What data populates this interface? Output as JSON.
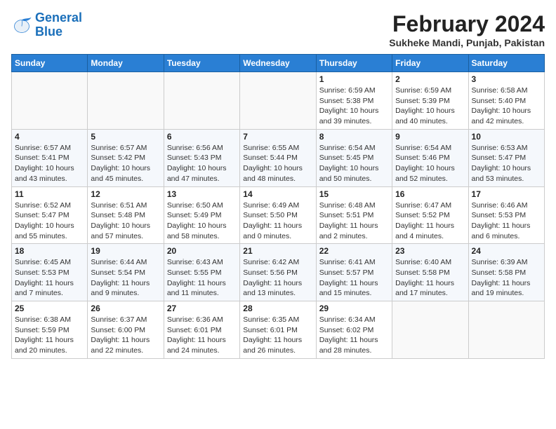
{
  "logo": {
    "line1": "General",
    "line2": "Blue"
  },
  "title": "February 2024",
  "location": "Sukheke Mandi, Punjab, Pakistan",
  "days_of_week": [
    "Sunday",
    "Monday",
    "Tuesday",
    "Wednesday",
    "Thursday",
    "Friday",
    "Saturday"
  ],
  "weeks": [
    [
      {
        "day": "",
        "info": ""
      },
      {
        "day": "",
        "info": ""
      },
      {
        "day": "",
        "info": ""
      },
      {
        "day": "",
        "info": ""
      },
      {
        "day": "1",
        "info": "Sunrise: 6:59 AM\nSunset: 5:38 PM\nDaylight: 10 hours\nand 39 minutes."
      },
      {
        "day": "2",
        "info": "Sunrise: 6:59 AM\nSunset: 5:39 PM\nDaylight: 10 hours\nand 40 minutes."
      },
      {
        "day": "3",
        "info": "Sunrise: 6:58 AM\nSunset: 5:40 PM\nDaylight: 10 hours\nand 42 minutes."
      }
    ],
    [
      {
        "day": "4",
        "info": "Sunrise: 6:57 AM\nSunset: 5:41 PM\nDaylight: 10 hours\nand 43 minutes."
      },
      {
        "day": "5",
        "info": "Sunrise: 6:57 AM\nSunset: 5:42 PM\nDaylight: 10 hours\nand 45 minutes."
      },
      {
        "day": "6",
        "info": "Sunrise: 6:56 AM\nSunset: 5:43 PM\nDaylight: 10 hours\nand 47 minutes."
      },
      {
        "day": "7",
        "info": "Sunrise: 6:55 AM\nSunset: 5:44 PM\nDaylight: 10 hours\nand 48 minutes."
      },
      {
        "day": "8",
        "info": "Sunrise: 6:54 AM\nSunset: 5:45 PM\nDaylight: 10 hours\nand 50 minutes."
      },
      {
        "day": "9",
        "info": "Sunrise: 6:54 AM\nSunset: 5:46 PM\nDaylight: 10 hours\nand 52 minutes."
      },
      {
        "day": "10",
        "info": "Sunrise: 6:53 AM\nSunset: 5:47 PM\nDaylight: 10 hours\nand 53 minutes."
      }
    ],
    [
      {
        "day": "11",
        "info": "Sunrise: 6:52 AM\nSunset: 5:47 PM\nDaylight: 10 hours\nand 55 minutes."
      },
      {
        "day": "12",
        "info": "Sunrise: 6:51 AM\nSunset: 5:48 PM\nDaylight: 10 hours\nand 57 minutes."
      },
      {
        "day": "13",
        "info": "Sunrise: 6:50 AM\nSunset: 5:49 PM\nDaylight: 10 hours\nand 58 minutes."
      },
      {
        "day": "14",
        "info": "Sunrise: 6:49 AM\nSunset: 5:50 PM\nDaylight: 11 hours\nand 0 minutes."
      },
      {
        "day": "15",
        "info": "Sunrise: 6:48 AM\nSunset: 5:51 PM\nDaylight: 11 hours\nand 2 minutes."
      },
      {
        "day": "16",
        "info": "Sunrise: 6:47 AM\nSunset: 5:52 PM\nDaylight: 11 hours\nand 4 minutes."
      },
      {
        "day": "17",
        "info": "Sunrise: 6:46 AM\nSunset: 5:53 PM\nDaylight: 11 hours\nand 6 minutes."
      }
    ],
    [
      {
        "day": "18",
        "info": "Sunrise: 6:45 AM\nSunset: 5:53 PM\nDaylight: 11 hours\nand 7 minutes."
      },
      {
        "day": "19",
        "info": "Sunrise: 6:44 AM\nSunset: 5:54 PM\nDaylight: 11 hours\nand 9 minutes."
      },
      {
        "day": "20",
        "info": "Sunrise: 6:43 AM\nSunset: 5:55 PM\nDaylight: 11 hours\nand 11 minutes."
      },
      {
        "day": "21",
        "info": "Sunrise: 6:42 AM\nSunset: 5:56 PM\nDaylight: 11 hours\nand 13 minutes."
      },
      {
        "day": "22",
        "info": "Sunrise: 6:41 AM\nSunset: 5:57 PM\nDaylight: 11 hours\nand 15 minutes."
      },
      {
        "day": "23",
        "info": "Sunrise: 6:40 AM\nSunset: 5:58 PM\nDaylight: 11 hours\nand 17 minutes."
      },
      {
        "day": "24",
        "info": "Sunrise: 6:39 AM\nSunset: 5:58 PM\nDaylight: 11 hours\nand 19 minutes."
      }
    ],
    [
      {
        "day": "25",
        "info": "Sunrise: 6:38 AM\nSunset: 5:59 PM\nDaylight: 11 hours\nand 20 minutes."
      },
      {
        "day": "26",
        "info": "Sunrise: 6:37 AM\nSunset: 6:00 PM\nDaylight: 11 hours\nand 22 minutes."
      },
      {
        "day": "27",
        "info": "Sunrise: 6:36 AM\nSunset: 6:01 PM\nDaylight: 11 hours\nand 24 minutes."
      },
      {
        "day": "28",
        "info": "Sunrise: 6:35 AM\nSunset: 6:01 PM\nDaylight: 11 hours\nand 26 minutes."
      },
      {
        "day": "29",
        "info": "Sunrise: 6:34 AM\nSunset: 6:02 PM\nDaylight: 11 hours\nand 28 minutes."
      },
      {
        "day": "",
        "info": ""
      },
      {
        "day": "",
        "info": ""
      }
    ]
  ]
}
